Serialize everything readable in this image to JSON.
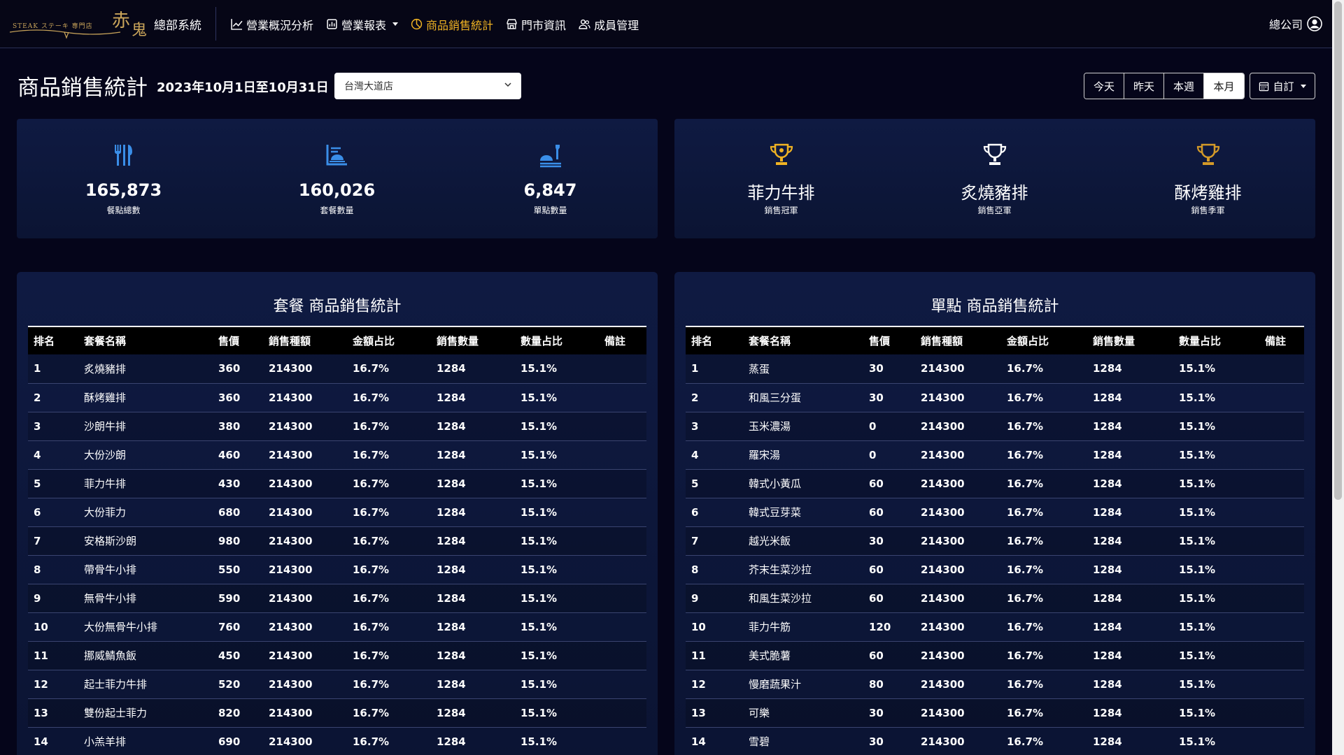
{
  "header": {
    "brand_logo_text": "STEAK ステーキ 専門店 赤鬼",
    "system_name": "總部系統",
    "nav": [
      {
        "label": "營業概況分析",
        "icon": "line-chart-icon",
        "dropdown": false,
        "active": false
      },
      {
        "label": "營業報表",
        "icon": "report-icon",
        "dropdown": true,
        "active": false
      },
      {
        "label": "商品銷售統計",
        "icon": "pie-chart-icon",
        "dropdown": false,
        "active": true
      },
      {
        "label": "門市資訊",
        "icon": "store-icon",
        "dropdown": false,
        "active": false
      },
      {
        "label": "成員管理",
        "icon": "users-icon",
        "dropdown": false,
        "active": false
      }
    ],
    "user_label": "總公司"
  },
  "page": {
    "title": "商品銷售統計",
    "date_range": "2023年10月1日至10月31日",
    "store_select": "台灣大道店",
    "range_buttons": [
      "今天",
      "昨天",
      "本週",
      "本月"
    ],
    "range_selected": "本月",
    "custom_label": "自訂"
  },
  "stats": [
    {
      "value": "165,873",
      "caption": "餐點總數",
      "icon": "utensils-icon"
    },
    {
      "value": "160,026",
      "caption": "套餐數量",
      "icon": "set-meal-icon"
    },
    {
      "value": "6,847",
      "caption": "單點數量",
      "icon": "single-item-icon"
    }
  ],
  "rankings": [
    {
      "name": "菲力牛排",
      "caption": "銷售冠軍",
      "icon": "trophy-gold-icon",
      "color": "#f0b323"
    },
    {
      "name": "炙燒豬排",
      "caption": "銷售亞軍",
      "icon": "trophy-silver-icon",
      "color": "#ffffff"
    },
    {
      "name": "酥烤雞排",
      "caption": "銷售季軍",
      "icon": "trophy-bronze-icon",
      "color": "#d49a28"
    }
  ],
  "colors": {
    "accent": "#f0b323",
    "background": "#05051a",
    "card": "#0f1a42"
  },
  "set_table": {
    "title": "套餐 商品銷售統計",
    "columns": [
      "排名",
      "套餐名稱",
      "售價",
      "銷售種額",
      "金額占比",
      "銷售數量",
      "數量占比",
      "備註"
    ],
    "rows": [
      [
        "1",
        "炙燒豬排",
        "360",
        "214300",
        "16.7%",
        "1284",
        "15.1%",
        ""
      ],
      [
        "2",
        "酥烤雞排",
        "360",
        "214300",
        "16.7%",
        "1284",
        "15.1%",
        ""
      ],
      [
        "3",
        "沙朗牛排",
        "380",
        "214300",
        "16.7%",
        "1284",
        "15.1%",
        ""
      ],
      [
        "4",
        "大份沙朗",
        "460",
        "214300",
        "16.7%",
        "1284",
        "15.1%",
        ""
      ],
      [
        "5",
        "菲力牛排",
        "430",
        "214300",
        "16.7%",
        "1284",
        "15.1%",
        ""
      ],
      [
        "6",
        "大份菲力",
        "680",
        "214300",
        "16.7%",
        "1284",
        "15.1%",
        ""
      ],
      [
        "7",
        "安格斯沙朗",
        "980",
        "214300",
        "16.7%",
        "1284",
        "15.1%",
        ""
      ],
      [
        "8",
        "帶骨牛小排",
        "550",
        "214300",
        "16.7%",
        "1284",
        "15.1%",
        ""
      ],
      [
        "9",
        "無骨牛小排",
        "590",
        "214300",
        "16.7%",
        "1284",
        "15.1%",
        ""
      ],
      [
        "10",
        "大份無骨牛小排",
        "760",
        "214300",
        "16.7%",
        "1284",
        "15.1%",
        ""
      ],
      [
        "11",
        "挪威鯖魚飯",
        "450",
        "214300",
        "16.7%",
        "1284",
        "15.1%",
        ""
      ],
      [
        "12",
        "起士菲力牛排",
        "520",
        "214300",
        "16.7%",
        "1284",
        "15.1%",
        ""
      ],
      [
        "13",
        "雙份起士菲力",
        "820",
        "214300",
        "16.7%",
        "1284",
        "15.1%",
        ""
      ],
      [
        "14",
        "小羔羊排",
        "690",
        "214300",
        "16.7%",
        "1284",
        "15.1%",
        ""
      ]
    ]
  },
  "single_table": {
    "title": "單點 商品銷售統計",
    "columns": [
      "排名",
      "套餐名稱",
      "售價",
      "銷售種額",
      "金額占比",
      "銷售數量",
      "數量占比",
      "備註"
    ],
    "rows": [
      [
        "1",
        "蒸蛋",
        "30",
        "214300",
        "16.7%",
        "1284",
        "15.1%",
        ""
      ],
      [
        "2",
        "和風三分蛋",
        "30",
        "214300",
        "16.7%",
        "1284",
        "15.1%",
        ""
      ],
      [
        "3",
        "玉米濃湯",
        "0",
        "214300",
        "16.7%",
        "1284",
        "15.1%",
        ""
      ],
      [
        "4",
        "羅宋湯",
        "0",
        "214300",
        "16.7%",
        "1284",
        "15.1%",
        ""
      ],
      [
        "5",
        "韓式小黃瓜",
        "60",
        "214300",
        "16.7%",
        "1284",
        "15.1%",
        ""
      ],
      [
        "6",
        "韓式豆芽菜",
        "60",
        "214300",
        "16.7%",
        "1284",
        "15.1%",
        ""
      ],
      [
        "7",
        "越光米飯",
        "30",
        "214300",
        "16.7%",
        "1284",
        "15.1%",
        ""
      ],
      [
        "8",
        "芥末生菜沙拉",
        "60",
        "214300",
        "16.7%",
        "1284",
        "15.1%",
        ""
      ],
      [
        "9",
        "和風生菜沙拉",
        "60",
        "214300",
        "16.7%",
        "1284",
        "15.1%",
        ""
      ],
      [
        "10",
        "菲力牛筋",
        "120",
        "214300",
        "16.7%",
        "1284",
        "15.1%",
        ""
      ],
      [
        "11",
        "美式脆薯",
        "60",
        "214300",
        "16.7%",
        "1284",
        "15.1%",
        ""
      ],
      [
        "12",
        "慢磨蔬果汁",
        "80",
        "214300",
        "16.7%",
        "1284",
        "15.1%",
        ""
      ],
      [
        "13",
        "可樂",
        "30",
        "214300",
        "16.7%",
        "1284",
        "15.1%",
        ""
      ],
      [
        "14",
        "雪碧",
        "30",
        "214300",
        "16.7%",
        "1284",
        "15.1%",
        ""
      ]
    ]
  }
}
